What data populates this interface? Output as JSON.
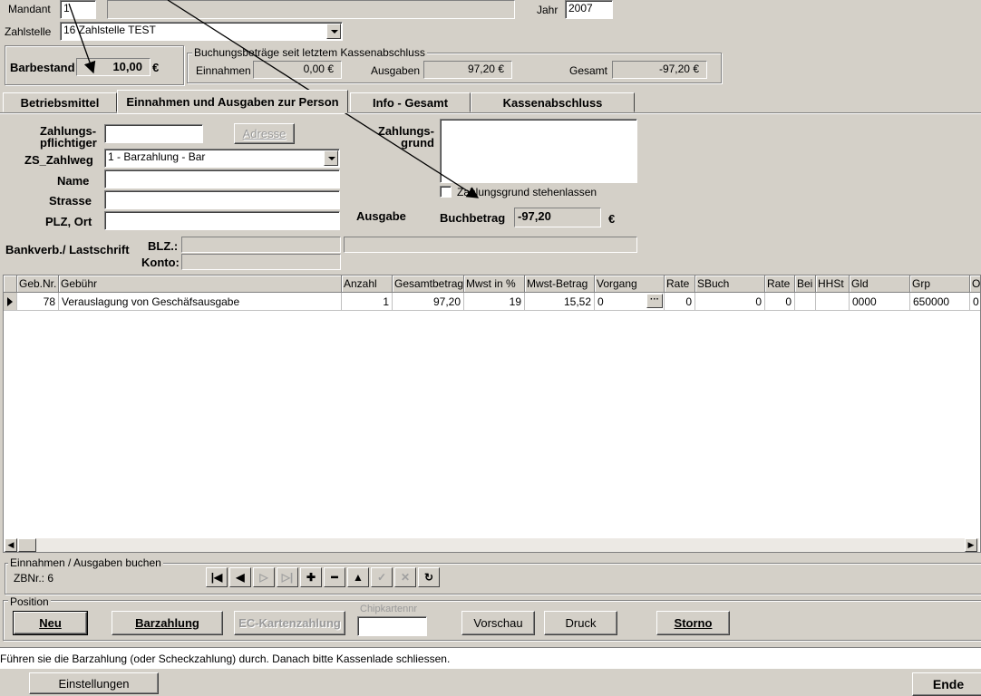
{
  "header": {
    "mandant_label": "Mandant",
    "mandant_value": "1",
    "jahr_label": "Jahr",
    "jahr_value": "2007",
    "zahlstelle_label": "Zahlstelle",
    "zahlstelle_value": "16  Zahlstelle TEST"
  },
  "barbestand": {
    "label": "Barbestand",
    "value": "10,00",
    "currency": "€"
  },
  "buchungsbetraege": {
    "title": "Buchungsbeträge seit letztem Kassenabschluss",
    "einnahmen_label": "Einnahmen",
    "einnahmen_value": "0,00 €",
    "ausgaben_label": "Ausgaben",
    "ausgaben_value": "97,20 €",
    "gesamt_label": "Gesamt",
    "gesamt_value": "-97,20  €"
  },
  "tabs": [
    {
      "label": "Betriebsmittel"
    },
    {
      "label": "Einnahmen und Ausgaben zur Person"
    },
    {
      "label": "Info - Gesamt"
    },
    {
      "label": "Kassenabschluss"
    }
  ],
  "form": {
    "zahlungspflichtiger_label_1": "Zahlungs-",
    "zahlungspflichtiger_label_2": "pflichtiger",
    "adresse_button": "Adresse",
    "zahlweg_label": "ZS_Zahlweg",
    "zahlweg_value": "1 - Barzahlung - Bar",
    "name_label": "Name",
    "strasse_label": "Strasse",
    "plz_label": "PLZ, Ort",
    "bankverb_label": "Bankverb./ Lastschrift",
    "blz_label": "BLZ.:",
    "konto_label": "Konto:",
    "zahlungsgrund_label_1": "Zahlungs-",
    "zahlungsgrund_label_2": "grund",
    "stehenlassen_label": "Zahlungsgrund stehenlassen",
    "ausgabe_label": "Ausgabe",
    "buchbetrag_label": "Buchbetrag",
    "buchbetrag_value": "-97,20",
    "buchbetrag_currency": "€"
  },
  "table": {
    "columns": [
      "Geb.Nr.",
      "Gebühr",
      "Anzahl",
      "Gesamtbetrag",
      "Mwst in %",
      "Mwst-Betrag",
      "Vorgang",
      "Rate",
      "SBuch",
      "Rate",
      "Bei",
      "HHSt",
      "Gld",
      "Grp",
      "O"
    ],
    "rows": [
      [
        "78",
        "Verauslagung von Geschäfsausgabe",
        "1",
        "97,20",
        "19",
        "15,52",
        "0",
        "0",
        "0",
        "0",
        "",
        "",
        "0000",
        "650000",
        "0"
      ]
    ],
    "ellipsis": "···"
  },
  "buchen": {
    "title": "Einnahmen / Ausgaben buchen",
    "zbnr": "ZBNr.: 6"
  },
  "nav_icons": [
    "first-icon",
    "prev-icon",
    "next-icon",
    "last-icon",
    "plus-icon",
    "minus-icon",
    "up-icon",
    "check-icon",
    "cancel-icon",
    "refresh-icon"
  ],
  "position": {
    "title": "Position",
    "neu": "Neu",
    "barzahlung": "Barzahlung",
    "ec": "EC-Kartenzahlung",
    "chipkarten_label": "Chipkartennr",
    "vorschau": "Vorschau",
    "druck": "Druck",
    "storno": "Storno"
  },
  "status": {
    "message": "Führen sie die Barzahlung (oder Scheckzahlung) durch. Danach bitte Kassenlade schliessen."
  },
  "footer": {
    "einstellungen": "Einstellungen",
    "ende": "Ende"
  }
}
